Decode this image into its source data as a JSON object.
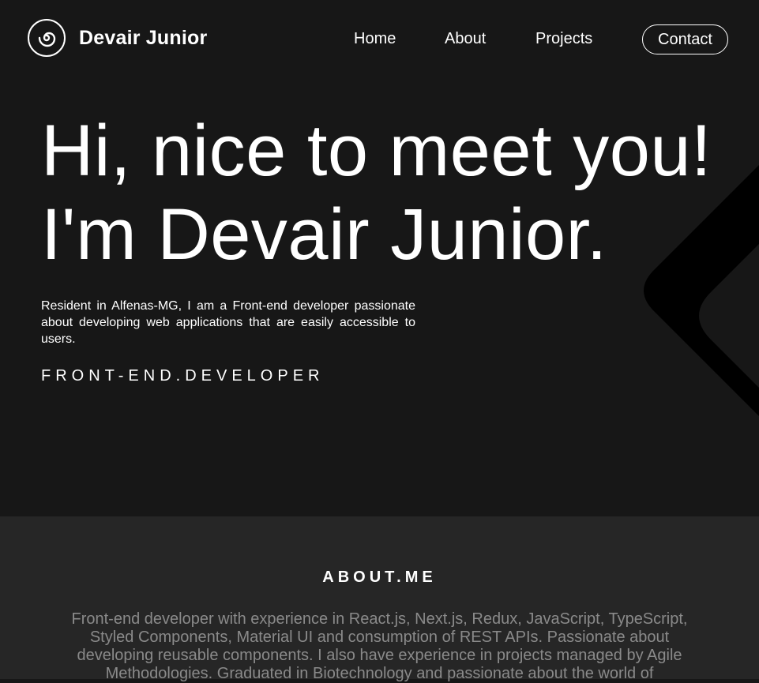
{
  "header": {
    "brand": "Devair Junior",
    "logo_icon": "spiral-logo-icon",
    "nav": [
      {
        "label": "Home"
      },
      {
        "label": "About"
      },
      {
        "label": "Projects"
      }
    ],
    "contact_label": "Contact"
  },
  "hero": {
    "headline_line1": "Hi, nice to meet you!",
    "headline_line2": "I'm Devair Junior.",
    "intro": "Resident in Alfenas-MG, I am a Front-end developer passionate about developing web applications that are easily accessible to users.",
    "role": "FRONT-END.DEVELOPER",
    "decoration_icon": "chevron-left-decoration"
  },
  "about": {
    "title": "ABOUT.ME",
    "text": "Front-end developer with experience in React.js, Next.js, Redux, JavaScript, TypeScript, Styled Components, Material UI and consumption of REST APIs. Passionate about developing reusable components. I also have experience in projects managed by Agile Methodologies. Graduated in Biotechnology and passionate about the world of"
  },
  "colors": {
    "hero_bg": "#171717",
    "about_bg": "#262626",
    "text": "#ffffff",
    "muted_text": "#8a8a8a"
  }
}
